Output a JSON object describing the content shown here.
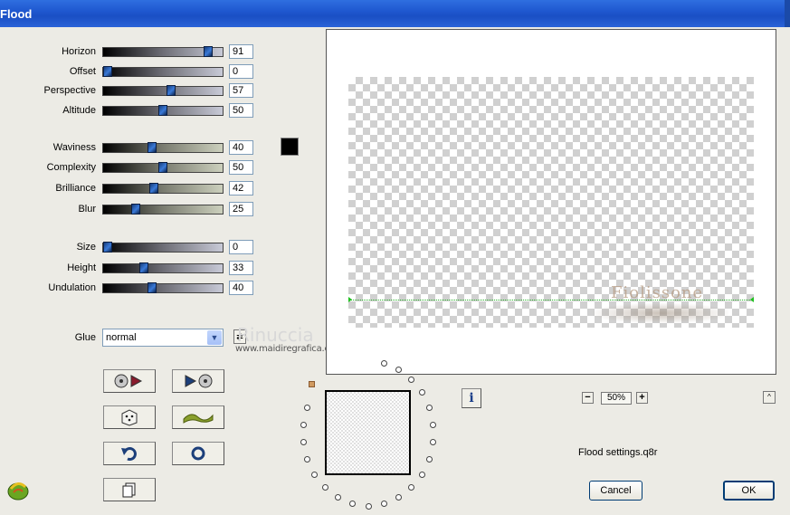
{
  "window": {
    "title": "Flood"
  },
  "sliders": [
    {
      "label": "Horizon",
      "value": "91",
      "level": 91
    },
    {
      "label": "Offset",
      "value": "0",
      "level": 0
    },
    {
      "label": "Perspective",
      "value": "57",
      "level": 57
    },
    {
      "label": "Altitude",
      "value": "50",
      "level": 50
    },
    {
      "label": "Waviness",
      "value": "40",
      "level": 40
    },
    {
      "label": "Complexity",
      "value": "50",
      "level": 50
    },
    {
      "label": "Brilliance",
      "value": "42",
      "level": 42
    },
    {
      "label": "Blur",
      "value": "25",
      "level": 25
    },
    {
      "label": "Size",
      "value": "0",
      "level": 0
    },
    {
      "label": "Height",
      "value": "33",
      "level": 33
    },
    {
      "label": "Undulation",
      "value": "40",
      "level": 40
    }
  ],
  "color_swatch": "#000000",
  "glue": {
    "label": "Glue",
    "value": "normal"
  },
  "watermark": {
    "name": "Rinuccia",
    "site": "www.maidiregrafica.eu"
  },
  "preset_buttons": [
    "prev-preset-icon",
    "next-preset-icon",
    "random-dice-icon",
    "wave-icon",
    "undo-icon",
    "reset-icon",
    "copy-icon"
  ],
  "preview": {
    "text": "Fiolissone"
  },
  "info_label": "i",
  "zoom": {
    "minus": "−",
    "value": "50%",
    "plus": "+",
    "up": "^"
  },
  "settings_file": "Flood settings.q8r",
  "buttons": {
    "cancel": "Cancel",
    "ok": "OK"
  }
}
